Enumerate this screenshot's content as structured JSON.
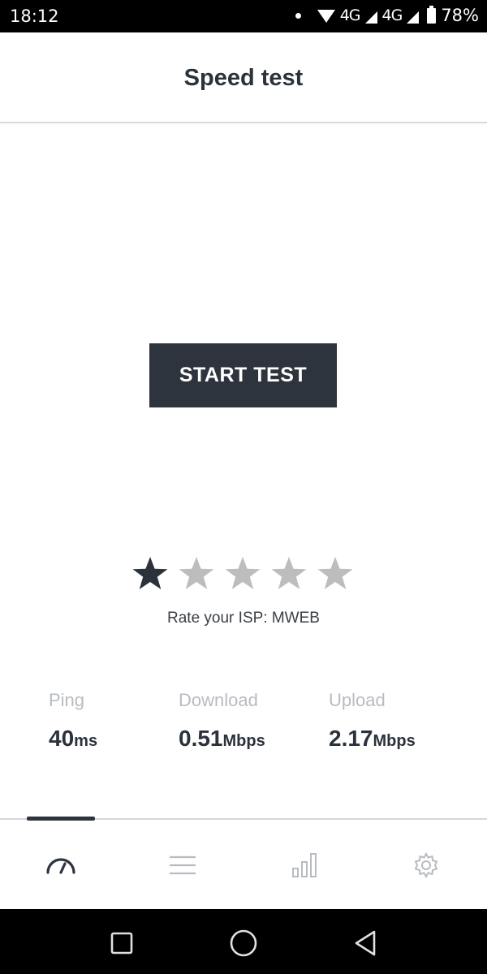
{
  "status_bar": {
    "time": "18:12",
    "network_1": "4G",
    "network_2": "4G",
    "battery": "78%"
  },
  "header": {
    "title": "Speed test"
  },
  "start_button": {
    "label": "START TEST"
  },
  "rating": {
    "value": 1,
    "max": 5,
    "label": "Rate your ISP: MWEB",
    "filled_color": "#2b323b",
    "empty_color": "#bdbdbd"
  },
  "metrics": [
    {
      "label": "Ping",
      "value": "40",
      "unit": "ms"
    },
    {
      "label": "Download",
      "value": "0.51",
      "unit": "Mbps"
    },
    {
      "label": "Upload",
      "value": "2.17",
      "unit": "Mbps"
    }
  ],
  "bottom_nav": {
    "items": [
      {
        "icon": "speedometer-icon",
        "active": true
      },
      {
        "icon": "menu-icon",
        "active": false
      },
      {
        "icon": "bar-chart-icon",
        "active": false
      },
      {
        "icon": "gear-icon",
        "active": false
      }
    ]
  },
  "system_nav": {
    "items": [
      "recent-apps-icon",
      "home-icon",
      "back-icon"
    ]
  },
  "colors": {
    "primary": "#2e343d",
    "muted_label": "#b8bcc1",
    "divider": "#d5d8db"
  }
}
